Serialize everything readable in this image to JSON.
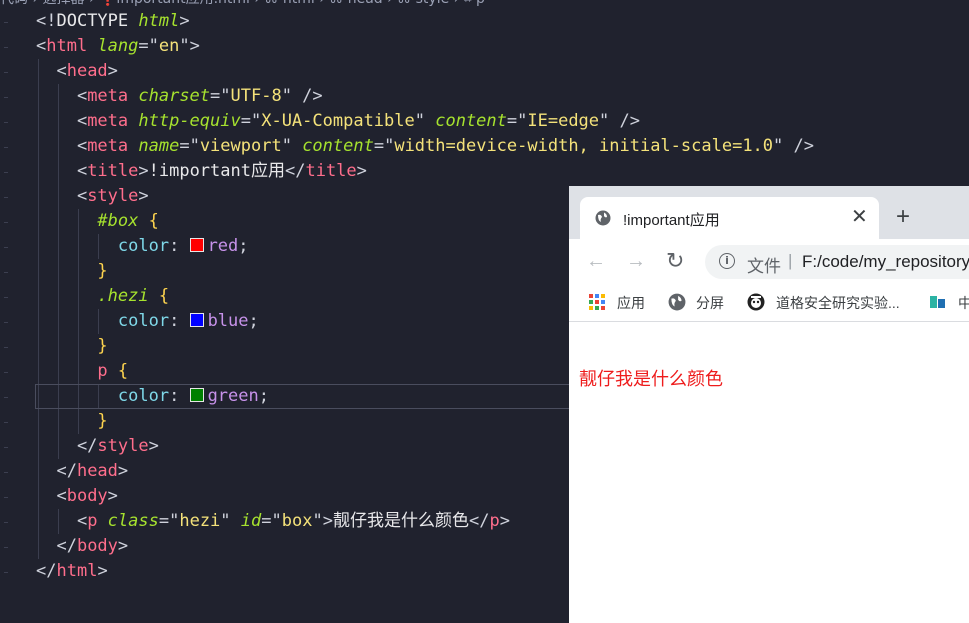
{
  "editor": {
    "breadcrumb": "代码 › 选择器 › ❗important应用.html › ⌘ html › ⌘ head › ⌘ style › ⌗ p",
    "lines": [
      {
        "tokens": [
          [
            "pun",
            "<!"
          ],
          [
            "doc",
            "DOCTYPE "
          ],
          [
            "doc2",
            "html"
          ],
          [
            "pun",
            ">"
          ]
        ]
      },
      {
        "tokens": [
          [
            "pun",
            "<"
          ],
          [
            "tag",
            "html "
          ],
          [
            "attr",
            "lang"
          ],
          [
            "pun",
            "=\""
          ],
          [
            "str",
            "en"
          ],
          [
            "pun",
            "\">"
          ]
        ]
      },
      {
        "tokens": [
          [
            "pun",
            "  <"
          ],
          [
            "tag",
            "head"
          ],
          [
            "pun",
            ">"
          ]
        ]
      },
      {
        "tokens": [
          [
            "pun",
            "    <"
          ],
          [
            "tag",
            "meta "
          ],
          [
            "attr",
            "charset"
          ],
          [
            "pun",
            "=\""
          ],
          [
            "str",
            "UTF-8"
          ],
          [
            "pun",
            "\" />"
          ]
        ]
      },
      {
        "tokens": [
          [
            "pun",
            "    <"
          ],
          [
            "tag",
            "meta "
          ],
          [
            "attr",
            "http-equiv"
          ],
          [
            "pun",
            "=\""
          ],
          [
            "str",
            "X-UA-Compatible"
          ],
          [
            "pun",
            "\" "
          ],
          [
            "attr",
            "content"
          ],
          [
            "pun",
            "=\""
          ],
          [
            "str",
            "IE=edge"
          ],
          [
            "pun",
            "\" />"
          ]
        ]
      },
      {
        "tokens": [
          [
            "pun",
            "    <"
          ],
          [
            "tag",
            "meta "
          ],
          [
            "attr",
            "name"
          ],
          [
            "pun",
            "=\""
          ],
          [
            "str",
            "viewport"
          ],
          [
            "pun",
            "\" "
          ],
          [
            "attr",
            "content"
          ],
          [
            "pun",
            "=\""
          ],
          [
            "str",
            "width=device-width, initial-scale=1.0"
          ],
          [
            "pun",
            "\" />"
          ]
        ]
      },
      {
        "tokens": [
          [
            "pun",
            "    <"
          ],
          [
            "tag",
            "title"
          ],
          [
            "pun",
            ">"
          ],
          [
            "text",
            "!important应用"
          ],
          [
            "pun",
            "</"
          ],
          [
            "tag",
            "title"
          ],
          [
            "pun",
            ">"
          ]
        ]
      },
      {
        "tokens": [
          [
            "pun",
            "    <"
          ],
          [
            "tag",
            "style"
          ],
          [
            "pun",
            ">"
          ]
        ]
      },
      {
        "tokens": [
          [
            "pun",
            "      "
          ],
          [
            "sel",
            "#box "
          ],
          [
            "brace",
            "{"
          ]
        ]
      },
      {
        "tokens": [
          [
            "pun",
            "        "
          ],
          [
            "prop",
            "color"
          ],
          [
            "pun",
            ": "
          ],
          [
            "swatch",
            "#ff0000"
          ],
          [
            "val",
            "red"
          ],
          [
            "pun",
            ";"
          ]
        ]
      },
      {
        "tokens": [
          [
            "pun",
            "      "
          ],
          [
            "brace",
            "}"
          ]
        ]
      },
      {
        "tokens": [
          [
            "pun",
            "      "
          ],
          [
            "sel",
            ".hezi "
          ],
          [
            "brace",
            "{"
          ]
        ]
      },
      {
        "tokens": [
          [
            "pun",
            "        "
          ],
          [
            "prop",
            "color"
          ],
          [
            "pun",
            ": "
          ],
          [
            "swatch",
            "#0000ff"
          ],
          [
            "val",
            "blue"
          ],
          [
            "pun",
            ";"
          ]
        ]
      },
      {
        "tokens": [
          [
            "pun",
            "      "
          ],
          [
            "brace",
            "}"
          ]
        ]
      },
      {
        "tokens": [
          [
            "pun",
            "      "
          ],
          [
            "tag",
            "p "
          ],
          [
            "brace",
            "{"
          ]
        ]
      },
      {
        "tokens": [
          [
            "pun",
            "        "
          ],
          [
            "prop",
            "color"
          ],
          [
            "pun",
            ": "
          ],
          [
            "swatch",
            "#008000"
          ],
          [
            "val",
            "green"
          ],
          [
            "pun",
            ";"
          ]
        ]
      },
      {
        "tokens": [
          [
            "pun",
            "      "
          ],
          [
            "brace",
            "}"
          ]
        ]
      },
      {
        "tokens": [
          [
            "pun",
            "    </"
          ],
          [
            "tag",
            "style"
          ],
          [
            "pun",
            ">"
          ]
        ]
      },
      {
        "tokens": [
          [
            "pun",
            "  </"
          ],
          [
            "tag",
            "head"
          ],
          [
            "pun",
            ">"
          ]
        ]
      },
      {
        "tokens": [
          [
            "pun",
            "  <"
          ],
          [
            "tag",
            "body"
          ],
          [
            "pun",
            ">"
          ]
        ]
      },
      {
        "tokens": [
          [
            "pun",
            "    <"
          ],
          [
            "tag",
            "p "
          ],
          [
            "attr",
            "class"
          ],
          [
            "pun",
            "=\""
          ],
          [
            "str",
            "hezi"
          ],
          [
            "pun",
            "\" "
          ],
          [
            "attr",
            "id"
          ],
          [
            "pun",
            "=\""
          ],
          [
            "str",
            "box"
          ],
          [
            "pun",
            "\">"
          ],
          [
            "text",
            "靓仔我是什么颜色"
          ],
          [
            "pun",
            "</"
          ],
          [
            "tag",
            "p"
          ],
          [
            "pun",
            ">"
          ]
        ]
      },
      {
        "tokens": [
          [
            "pun",
            "  </"
          ],
          [
            "tag",
            "body"
          ],
          [
            "pun",
            ">"
          ]
        ]
      },
      {
        "tokens": [
          [
            "pun",
            "</"
          ],
          [
            "tag",
            "html"
          ],
          [
            "pun",
            ">"
          ]
        ]
      }
    ]
  },
  "browser": {
    "tab_title": "!important应用",
    "tab_close": "✕",
    "new_tab": "+",
    "back": "←",
    "forward": "→",
    "reload": "↻",
    "info_glyph": "i",
    "url_scheme": "文件",
    "url_sep": "|",
    "url": "F:/code/my_repository",
    "bookmarks": [
      {
        "label": "应用",
        "icon": "apps-grid-icon"
      },
      {
        "label": "分屏",
        "icon": "globe-icon"
      },
      {
        "label": "道格安全研究实验...",
        "icon": "dog-logo-icon"
      },
      {
        "label": "中",
        "icon": "bookmark-chart-icon"
      }
    ],
    "page_text": "靓仔我是什么颜色",
    "page_text_color": "#ee1c1c"
  }
}
